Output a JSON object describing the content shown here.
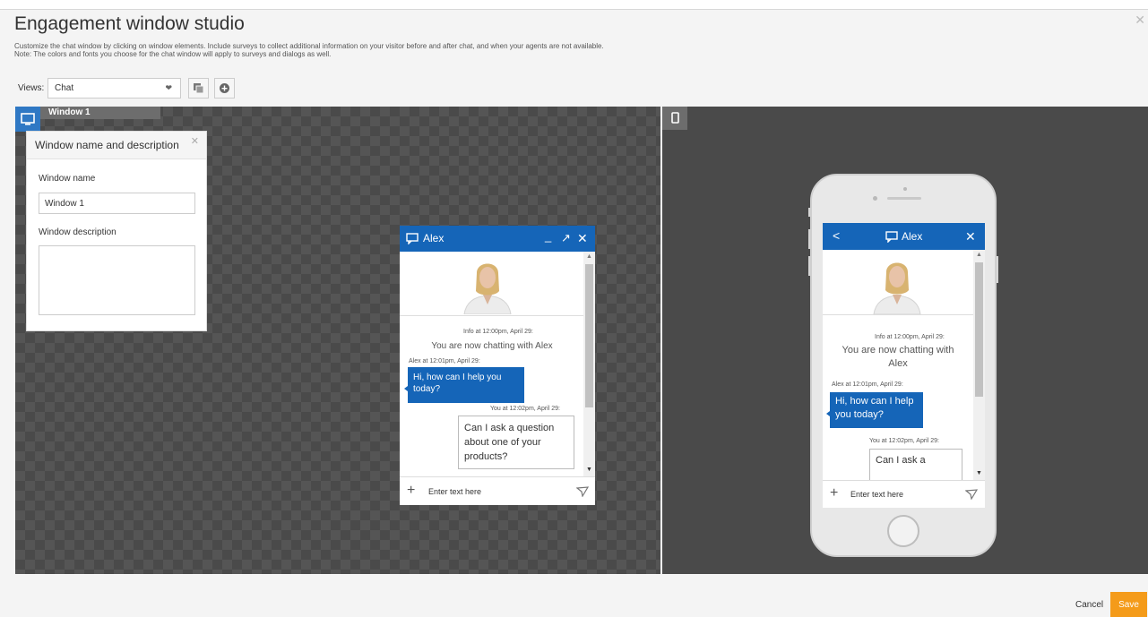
{
  "header": {
    "title": "Engagement window studio",
    "description_line1": "Customize the chat window by clicking on window elements. Include surveys to collect additional information on your visitor before and after chat, and when your agents are not available.",
    "description_line2": "Note: The colors and fonts you choose for the chat window will apply to surveys and dialogs as well.",
    "close_icon": "close-icon"
  },
  "views": {
    "label": "Views:",
    "selected": "Chat",
    "actions": [
      "copy-icon",
      "add-circle-icon"
    ]
  },
  "tabs": {
    "window_tab_label": "Window 1",
    "desktop_icon": "monitor-icon",
    "mobile_icon": "mobile-icon"
  },
  "panel": {
    "title": "Window name and description",
    "name_label": "Window name",
    "name_value": "Window 1",
    "description_label": "Window description",
    "description_value": ""
  },
  "chat": {
    "agent_name": "Alex",
    "info_time": "Info at 12:00pm, April 29:",
    "system_message": "You are now chatting with Alex",
    "agent_time": "Alex at 12:01pm, April 29:",
    "agent_message": "Hi, how can I help you today?",
    "user_time": "You at 12:02pm, April 29:",
    "user_message": "Can I ask a question about one of your products?",
    "input_placeholder": "Enter text here",
    "mobile_user_message_visible": "Can I ask a"
  },
  "colors": {
    "brand_blue": "#1565b8",
    "save_orange": "#f49b1a",
    "canvas_dark": "#4a4a4a"
  },
  "footer": {
    "cancel_label": "Cancel",
    "save_label": "Save"
  }
}
